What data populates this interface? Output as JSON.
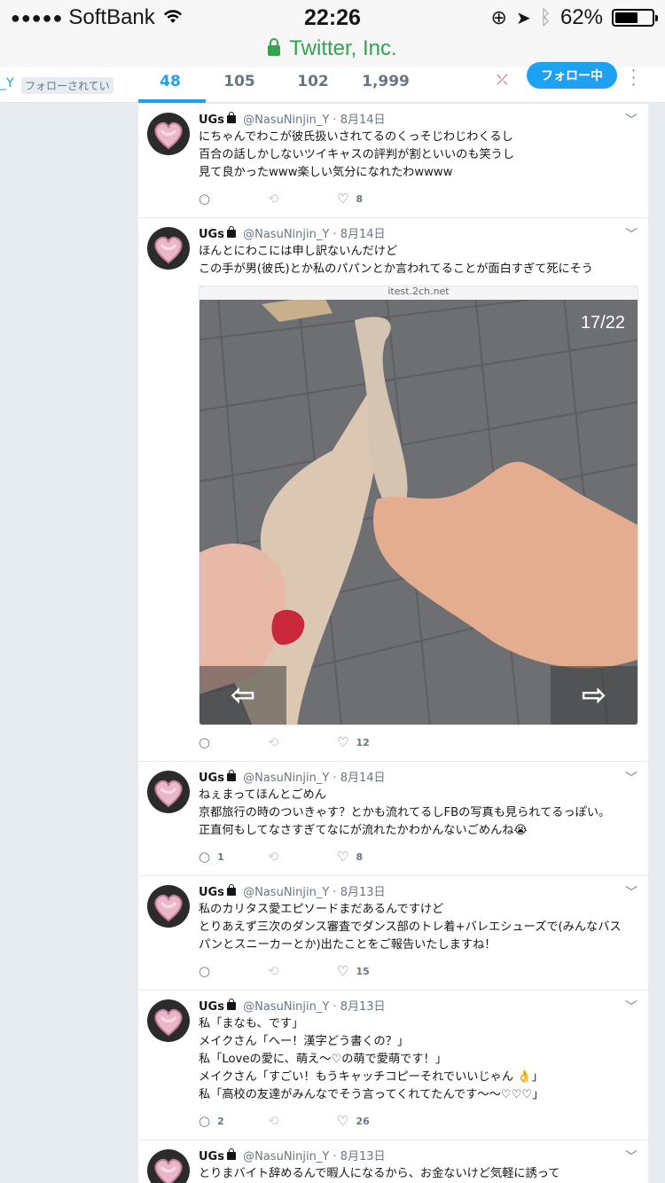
{
  "status": {
    "carrier": "SoftBank",
    "time": "22:26",
    "battery": "62%",
    "battery_level": 0.62
  },
  "url": "Twitter, Inc.",
  "profile_nav": {
    "handle_fragment": "_Y",
    "follows_you": "フォローされてい",
    "stats": [
      "48",
      "105",
      "102",
      "1,999"
    ],
    "follow_button": "フォロー中"
  },
  "tweets": [
    {
      "name": "UGs",
      "handle": "@NasuNinjin_Y",
      "date": "8月14日",
      "text": "にちゃんでわこが彼氏扱いされてるのくっそじわじわくるし\n百合の話しかしないツイキャスの評判が割といいのも笑うし\n見て良かったwww楽しい気分になれたわwwww",
      "replies": "",
      "likes": "8"
    },
    {
      "name": "UGs",
      "handle": "@NasuNinjin_Y",
      "date": "8月14日",
      "text": "ほんとにわこには申し訳ないんだけど\nこの手が男(彼氏)とか私のパパンとか言われてることが面白すぎて死にそう",
      "media_source": "itest.2ch.net",
      "media_counter": "17/22",
      "replies": "",
      "likes": "12"
    },
    {
      "name": "UGs",
      "handle": "@NasuNinjin_Y",
      "date": "8月14日",
      "text": "ねぇまってほんとごめん\n京都旅行の時のついきゃす？とかも流れてるしFBの写真も見られてるっぽい。\n正直何もしてなさすぎてなにが流れたかわかんないごめんね😭",
      "replies": "1",
      "likes": "8"
    },
    {
      "name": "UGs",
      "handle": "@NasuNinjin_Y",
      "date": "8月13日",
      "text": "私のカリタス愛エピソードまだあるんですけど\nとりあえず三次のダンス審査でダンス部のトレ着+バレエシューズで(みんなバス\nパンとスニーカーとか)出たことをご報告いたしますね！",
      "replies": "",
      "likes": "15"
    },
    {
      "name": "UGs",
      "handle": "@NasuNinjin_Y",
      "date": "8月13日",
      "text": "私「まなも、です」\nメイクさん「へー！漢字どう書くの？」\n私「Loveの愛に、萌え〜♡の萌で愛萌です！」\nメイクさん「すごい！もうキャッチコピーそれでいいじゃん 👌」\n私「高校の友達がみんなでそう言ってくれてたんです〜〜♡♡♡」",
      "replies": "2",
      "likes": "26"
    },
    {
      "name": "UGs",
      "handle": "@NasuNinjin_Y",
      "date": "8月13日",
      "text": "とりまバイト辞めるんで暇人になるから、お金ないけど気軽に誘って",
      "replies": "",
      "likes": ""
    }
  ]
}
